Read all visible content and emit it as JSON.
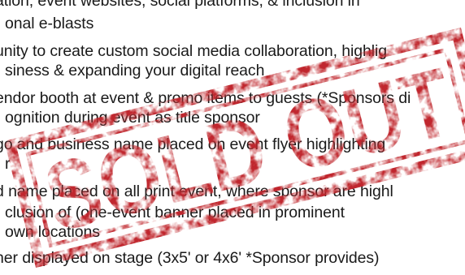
{
  "document": {
    "lines": [
      "ation; event websites, social platforms, & inclusion in",
      "onal e-blasts",
      "unity to create custom social media collaboration, highlig",
      "siness & expanding your digital reach",
      "endor booth at event & promo items to guests (*Sponsors di",
      "ognition during event as title sponsor",
      "go and business name placed on event flyer highlighting",
      "r",
      "d name placed on all print event, where sponsor are highl",
      "clusion of (one-event banner placed in prominent",
      "own locations",
      "ner displayed on stage (3x5' or 4x6' *Sponsor provides)"
    ]
  },
  "stamp": {
    "text": "SOLD OUT",
    "color": "#c0272d",
    "rotation_deg": -14
  }
}
